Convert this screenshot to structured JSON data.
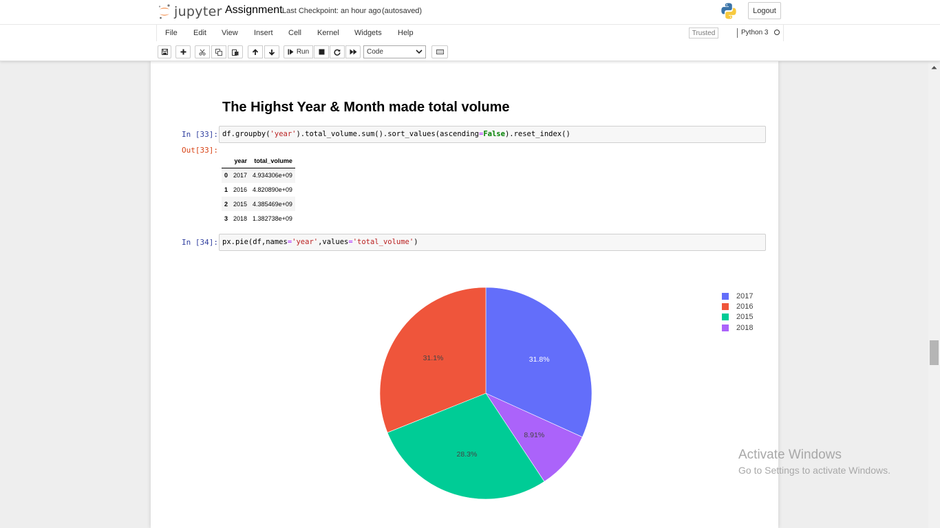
{
  "app": {
    "logo_text": "jupyter",
    "notebook_name": "Assignment",
    "checkpoint": "Last Checkpoint: an hour ago",
    "autosave": "(autosaved)",
    "logout_label": "Logout"
  },
  "menu": [
    "File",
    "Edit",
    "View",
    "Insert",
    "Cell",
    "Kernel",
    "Widgets",
    "Help"
  ],
  "status": {
    "trusted": "Trusted",
    "kernel": "Python 3"
  },
  "toolbar": {
    "run_label": "Run",
    "cell_type": "Code",
    "icons": [
      "save-icon",
      "plus-icon",
      "cut-icon",
      "copy-icon",
      "paste-icon",
      "arrow-up-icon",
      "arrow-down-icon",
      "run-icon",
      "stop-icon",
      "restart-icon",
      "fast-forward-icon",
      "keyboard-icon"
    ]
  },
  "cells": {
    "heading": "The Highst Year & Month made total volume",
    "cell33": {
      "in_prompt": "In [33]:",
      "out_prompt": "Out[33]:",
      "code_plain_1": "df.groupby(",
      "code_str_1": "'year'",
      "code_plain_2": ").total_volume.sum().sort_values(ascending",
      "code_op": "=",
      "code_kw": "False",
      "code_plain_3": ").reset_index()"
    },
    "dataframe": {
      "columns": [
        "",
        "year",
        "total_volume"
      ],
      "rows": [
        [
          "0",
          "2017",
          "4.934306e+09"
        ],
        [
          "1",
          "2016",
          "4.820890e+09"
        ],
        [
          "2",
          "2015",
          "4.385469e+09"
        ],
        [
          "3",
          "2018",
          "1.382738e+09"
        ]
      ]
    },
    "cell34": {
      "in_prompt": "In [34]:",
      "code_plain_1": "px.pie(df,names",
      "code_op_1": "=",
      "code_str_1": "'year'",
      "code_plain_2": ",values",
      "code_op_2": "=",
      "code_str_2": "'total_volume'",
      "code_plain_3": ")"
    }
  },
  "chart_data": {
    "type": "pie",
    "categories": [
      "2017",
      "2016",
      "2015",
      "2018"
    ],
    "values": [
      4934306000.0,
      4820890000.0,
      4385469000.0,
      1382738000.0
    ],
    "labels": [
      "31.8%",
      "31.1%",
      "28.3%",
      "8.91%"
    ],
    "colors": [
      "#636efa",
      "#ef553b",
      "#00cc96",
      "#ab63fa"
    ],
    "slice_order": [
      "2017",
      "2018",
      "2015",
      "2016"
    ],
    "direction": "clockwise",
    "start": "12 o'clock",
    "legend_position": "top-right"
  },
  "watermark": {
    "title": "Activate Windows",
    "subtitle": "Go to Settings to activate Windows."
  }
}
